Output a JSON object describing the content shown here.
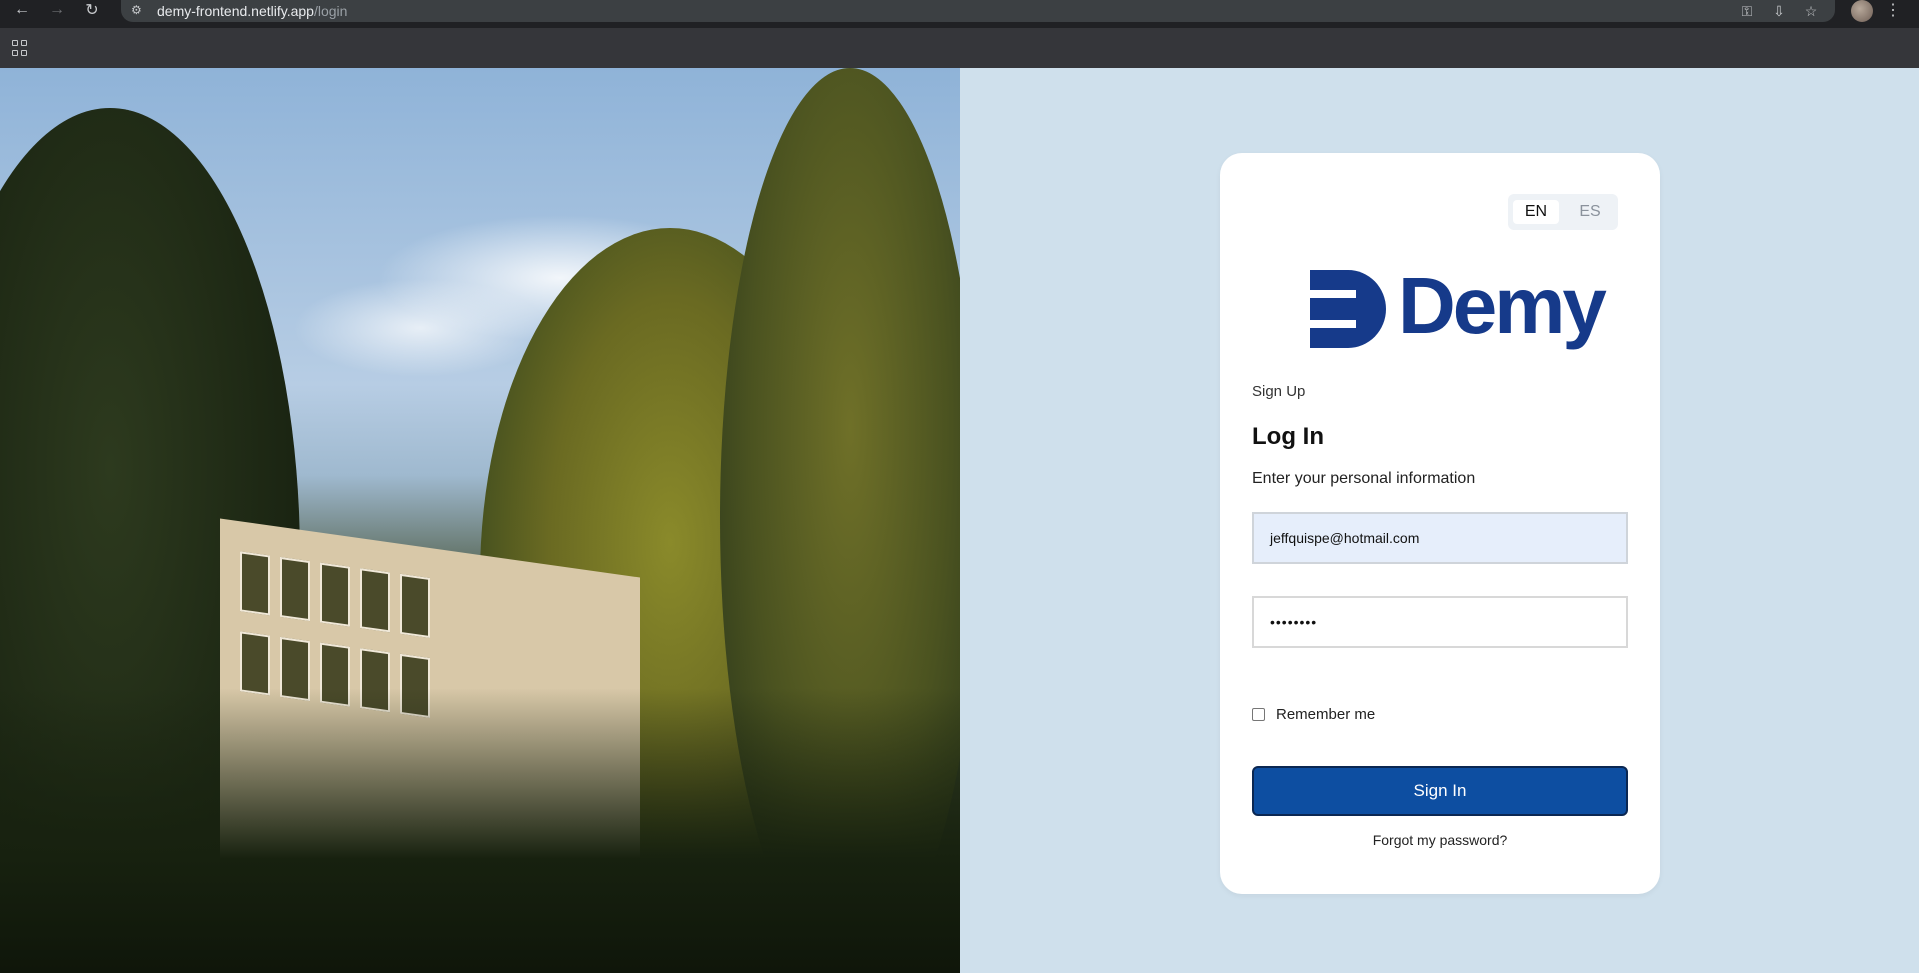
{
  "browser": {
    "url_domain": "demy-frontend.netlify.app",
    "url_path": "/login",
    "nav": {
      "back": "back-icon",
      "forward": "forward-icon",
      "reload": "reload-icon"
    },
    "icons": [
      "key-icon",
      "install-icon",
      "bookmark-star-icon",
      "profile-avatar",
      "more-menu-icon",
      "apps-grid-icon"
    ]
  },
  "login": {
    "languages": [
      {
        "code": "EN",
        "active": true
      },
      {
        "code": "ES",
        "active": false
      }
    ],
    "logo_text": "Demy",
    "signup_label": "Sign Up",
    "title": "Log In",
    "subtitle": "Enter your personal information",
    "email_value": "jeffquispe@hotmail.com",
    "password_masked": "••••••••",
    "remember_label": "Remember me",
    "remember_checked": false,
    "signin_label": "Sign In",
    "forgot_label": "Forgot my password?"
  },
  "colors": {
    "brand": "#163a8a",
    "button": "#0d4ea1",
    "page_background": "#cfe0ec",
    "email_autofill": "#e6eefb"
  }
}
